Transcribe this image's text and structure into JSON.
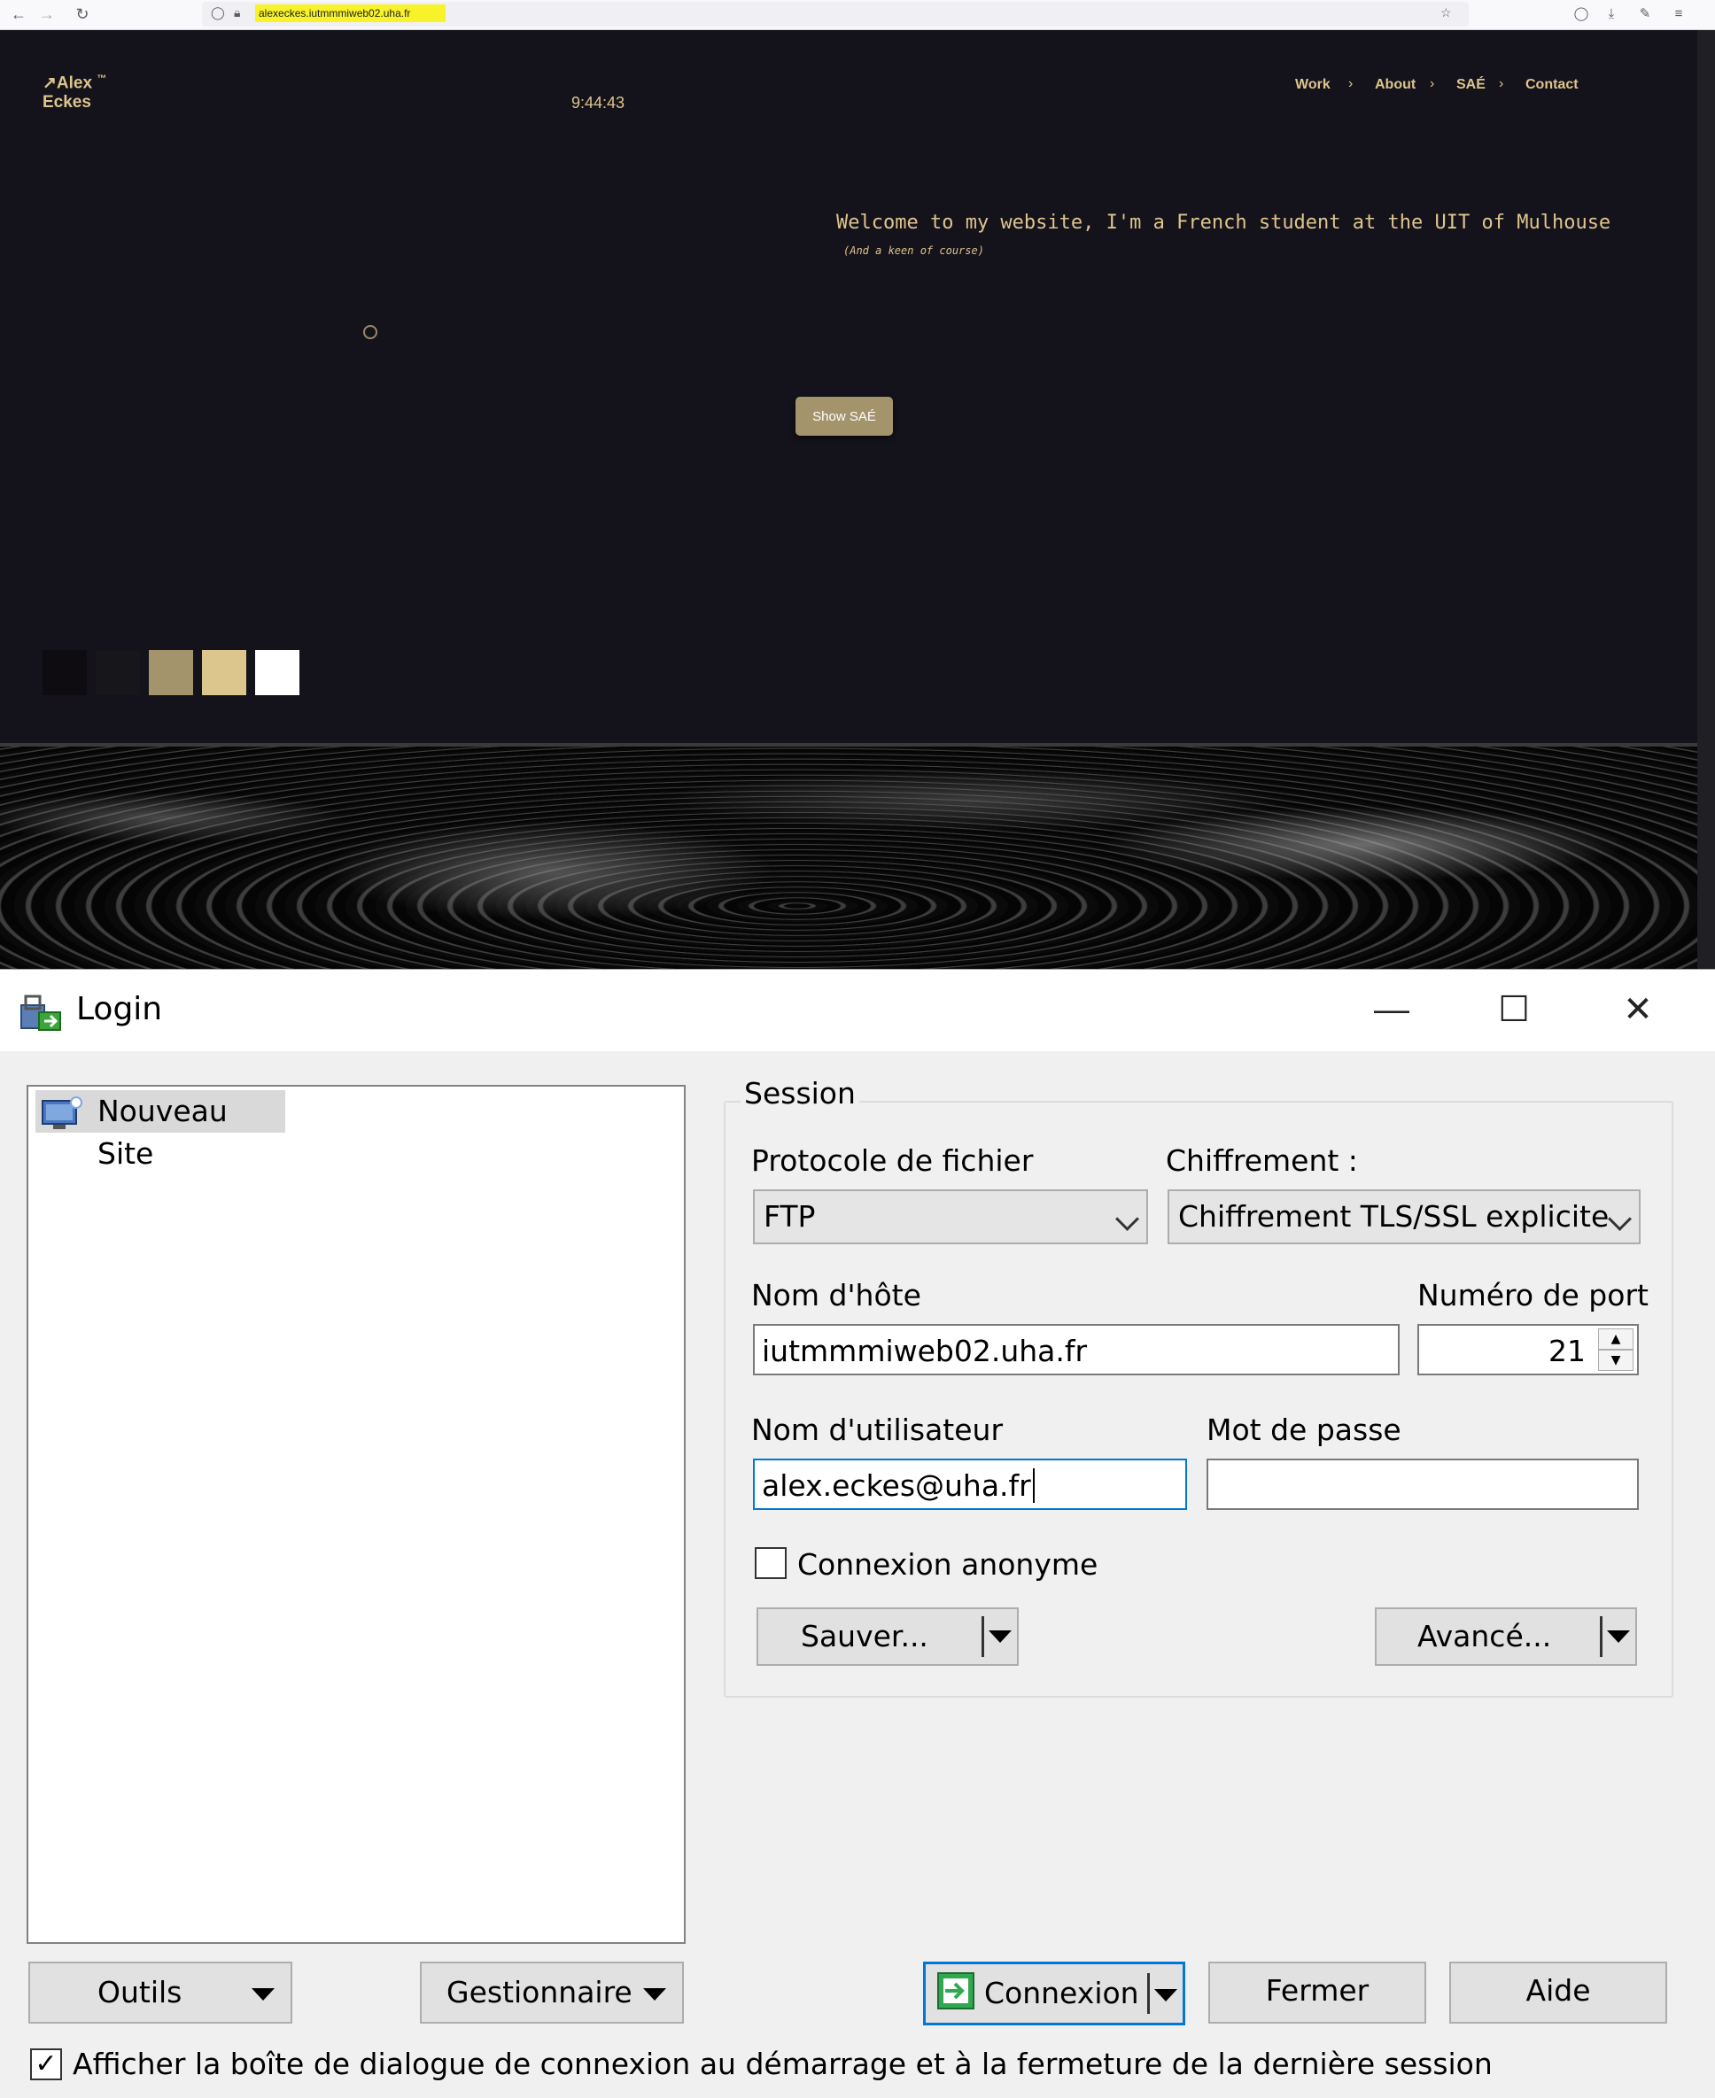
{
  "browser": {
    "url": "alexeckes.iutmmmiweb02.uha.fr",
    "back_icon": "arrow-left-icon",
    "forward_icon": "arrow-right-icon",
    "reload_icon": "reload-icon"
  },
  "site": {
    "logo_line1": "↗Alex",
    "logo_tm": "™",
    "logo_line2": "Eckes",
    "clock": "9:44:43",
    "nav": [
      "Work",
      "About",
      "SAÉ",
      "Contact"
    ],
    "welcome": "Welcome to my website, I'm a French student at the UIT of Mulhouse",
    "welcome_note": "(And a keen of course)",
    "show_button": "Show SAÉ",
    "swatches": [
      "#0e0c11",
      "#17161b",
      "#a3946c",
      "#ddc58e",
      "#ffffff"
    ],
    "accent": "#ddc58e"
  },
  "dialog": {
    "title": "Login",
    "site_item": "Nouveau Site",
    "session_label": "Session",
    "protocol_label": "Protocole de fichier",
    "protocol_value": "FTP",
    "encryption_label": "Chiffrement :",
    "encryption_value": "Chiffrement TLS/SSL explicite",
    "host_label": "Nom d'hôte",
    "host_value": "iutmmmiweb02.uha.fr",
    "port_label": "Numéro de port",
    "port_value": "21",
    "user_label": "Nom d'utilisateur",
    "user_value": "alex.eckes@uha.fr",
    "password_label": "Mot de passe",
    "password_value": "",
    "anonymous_label": "Connexion anonyme",
    "save_button": "Sauver...",
    "advanced_button": "Avancé...",
    "tools_button": "Outils",
    "manager_button": "Gestionnaire",
    "connect_button": "Connexion",
    "close_button": "Fermer",
    "help_button": "Aide",
    "startup_checkbox_label": "Afficher la boîte de dialogue de connexion au démarrage et à la fermeture de la dernière session"
  }
}
